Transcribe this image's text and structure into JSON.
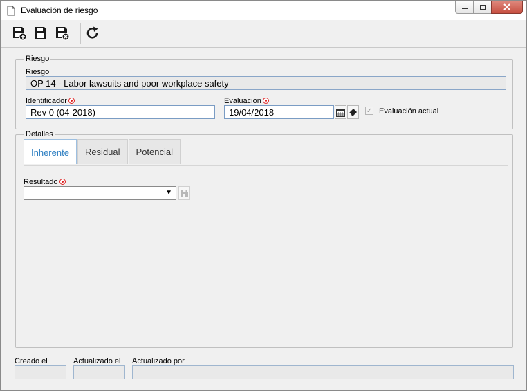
{
  "window": {
    "title": "Evaluación de riesgo"
  },
  "toolbar": {
    "buttons": [
      {
        "icon": "save-new-icon"
      },
      {
        "icon": "save-icon"
      },
      {
        "icon": "save-close-icon"
      },
      {
        "icon": "refresh-icon"
      }
    ]
  },
  "riesgo": {
    "legend": "Riesgo",
    "riesgo_label": "Riesgo",
    "riesgo_value": "OP 14 - Labor lawsuits and poor workplace safety",
    "identificador_label": "Identificador",
    "identificador_value": "Rev 0 (04-2018)",
    "evaluacion_label": "Evaluación",
    "evaluacion_value": "19/04/2018",
    "evaluacion_actual_label": "Evaluación actual"
  },
  "detalles": {
    "legend": "Detalles",
    "tabs": [
      {
        "label": "Inherente"
      },
      {
        "label": "Residual"
      },
      {
        "label": "Potencial"
      }
    ],
    "resultado_label": "Resultado",
    "resultado_value": ""
  },
  "footer": {
    "creado_label": "Creado el",
    "actualizado_label": "Actualizado el",
    "actualizado_por_label": "Actualizado por"
  },
  "colors": {
    "accent": "#2e7fc2",
    "required": "#dd2222"
  }
}
